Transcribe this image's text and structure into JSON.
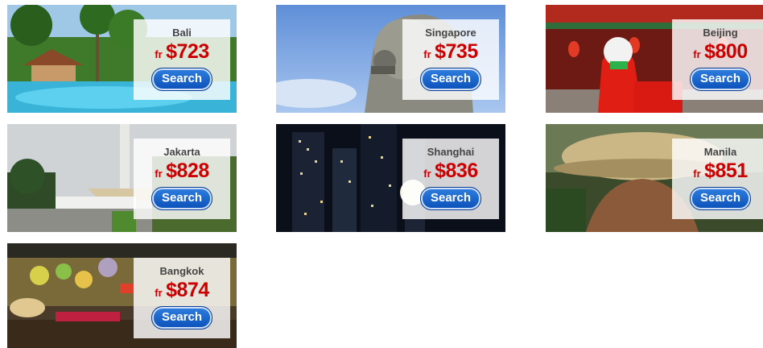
{
  "deals": [
    {
      "city": "Bali",
      "from": "fr",
      "price": "$723",
      "cta": "Search"
    },
    {
      "city": "Singapore",
      "from": "fr",
      "price": "$735",
      "cta": "Search"
    },
    {
      "city": "Beijing",
      "from": "fr",
      "price": "$800",
      "cta": "Search"
    },
    {
      "city": "Jakarta",
      "from": "fr",
      "price": "$828",
      "cta": "Search"
    },
    {
      "city": "Shanghai",
      "from": "fr",
      "price": "$836",
      "cta": "Search"
    },
    {
      "city": "Manila",
      "from": "fr",
      "price": "$851",
      "cta": "Search"
    },
    {
      "city": "Bangkok",
      "from": "fr",
      "price": "$874",
      "cta": "Search"
    }
  ]
}
